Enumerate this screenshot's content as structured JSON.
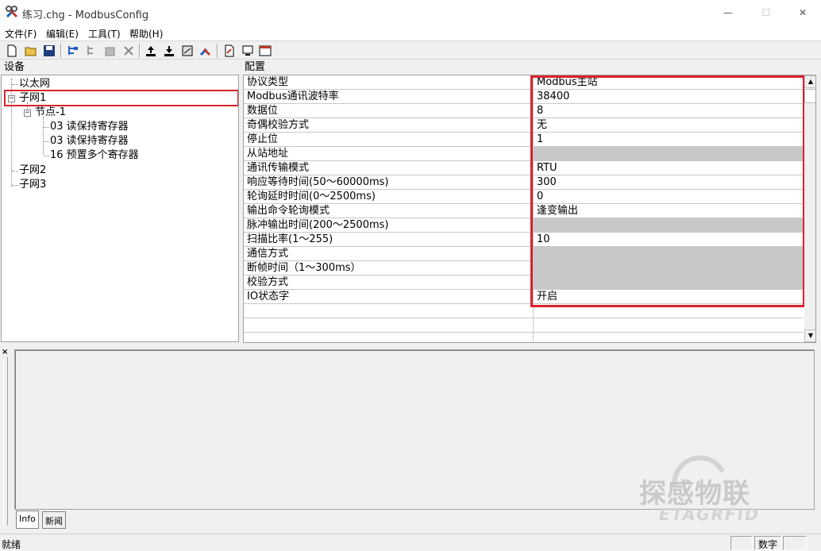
{
  "window": {
    "title": "练习.chg - ModbusConfig",
    "min_glyph": "—",
    "max_glyph": "☐",
    "close_glyph": "✕"
  },
  "menu": [
    "文件(F)",
    "编辑(E)",
    "工具(T)",
    "帮助(H)"
  ],
  "toolbar_icons": [
    "new-file-icon",
    "open-folder-icon",
    "save-icon",
    "add-subnet-icon",
    "add-node-icon",
    "properties-icon",
    "delete-icon",
    "upload-icon",
    "download-icon",
    "config-icon",
    "tools-icon",
    "export-icon",
    "monitor-icon",
    "calendar-icon"
  ],
  "left_pane": {
    "header": "设备",
    "tree": {
      "ethernet": "以太网",
      "subnet1": "子网1",
      "node1": "节点-1",
      "cmd1": "03 读保持寄存器",
      "cmd2": "03 读保持寄存器",
      "cmd3": "16 预置多个寄存器",
      "subnet2": "子网2",
      "subnet3": "子网3"
    }
  },
  "right_pane": {
    "header": "配置",
    "rows": [
      {
        "key": "协议类型",
        "value": "Modbus主站",
        "disabled": false
      },
      {
        "key": "Modbus通讯波特率",
        "value": "38400",
        "disabled": false
      },
      {
        "key": "数据位",
        "value": "8",
        "disabled": false
      },
      {
        "key": "奇偶校验方式",
        "value": "无",
        "disabled": false
      },
      {
        "key": "停止位",
        "value": "1",
        "disabled": false
      },
      {
        "key": "从站地址",
        "value": "",
        "disabled": true
      },
      {
        "key": "通讯传输模式",
        "value": "RTU",
        "disabled": false
      },
      {
        "key": "响应等待时间(50～60000ms)",
        "value": "300",
        "disabled": false
      },
      {
        "key": "轮询延时时间(0～2500ms)",
        "value": "0",
        "disabled": false
      },
      {
        "key": "输出命令轮询模式",
        "value": "逢变输出",
        "disabled": false
      },
      {
        "key": "脉冲输出时间(200～2500ms)",
        "value": "",
        "disabled": true
      },
      {
        "key": "扫描比率(1～255)",
        "value": "10",
        "disabled": false
      },
      {
        "key": "通信方式",
        "value": "",
        "disabled": true
      },
      {
        "key": "断帧时间（1～300ms）",
        "value": "",
        "disabled": true
      },
      {
        "key": "校验方式",
        "value": "",
        "disabled": true
      },
      {
        "key": "IO状态字",
        "value": "开启",
        "disabled": false
      }
    ],
    "scroll_up": "▲",
    "scroll_down": "▼"
  },
  "info_panel": {
    "close": "×",
    "tabs": [
      "Info",
      "新闻"
    ]
  },
  "watermark": {
    "text": "探感物联",
    "sub": "ETAGRFID"
  },
  "status": {
    "text": "就绪",
    "mode": "数字"
  },
  "colors": {
    "highlight": "#d9232d",
    "disabled_cell": "#c8c8c8"
  }
}
